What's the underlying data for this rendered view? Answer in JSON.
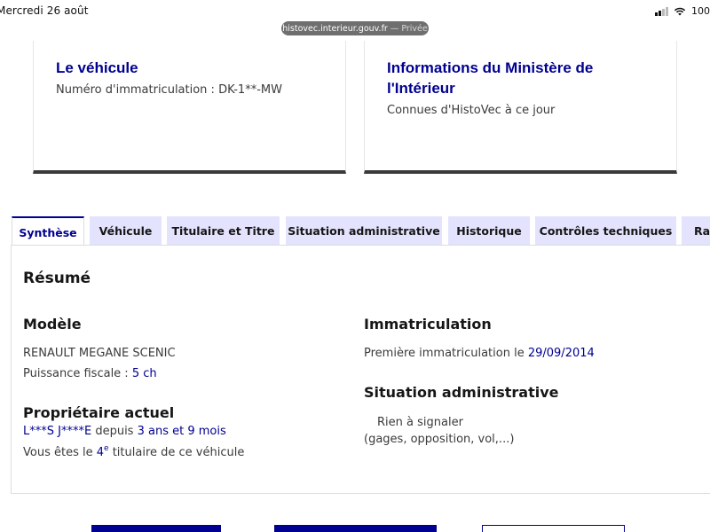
{
  "status_bar": {
    "time": "Mercredi 26 août",
    "battery": "100"
  },
  "browser": {
    "domain": "histovec.interieur.gouv.fr",
    "separator": "—",
    "mode": "Privée"
  },
  "cards": {
    "vehicle": {
      "title": "Le véhicule",
      "text": "Numéro d'immatriculation : DK-1**-MW"
    },
    "ministry": {
      "title": "Informations du Ministère de l'Intérieur",
      "text": "Connues d'HistoVec à ce jour"
    }
  },
  "tabs": [
    {
      "label": "Synthèse",
      "active": true
    },
    {
      "label": "Véhicule",
      "active": false
    },
    {
      "label": "Titulaire et Titre",
      "active": false
    },
    {
      "label": "Situation administrative",
      "active": false
    },
    {
      "label": "Historique",
      "active": false
    },
    {
      "label": "Contrôles techniques",
      "active": false
    },
    {
      "label": "Rap",
      "active": false
    }
  ],
  "summary": {
    "title": "Résumé",
    "model": {
      "heading": "Modèle",
      "name": "RENAULT MEGANE SCENIC",
      "power_label": "Puissance fiscale :",
      "power_value": "5 ch"
    },
    "owner": {
      "heading": "Propriétaire actuel",
      "name": "L***S J****E",
      "since_label": "depuis",
      "since_value": "3 ans et 9 mois",
      "rank_prefix": "Vous êtes le",
      "rank_number": "4",
      "rank_suffix_sup": "e",
      "rank_suffix": "titulaire de ce véhicule"
    },
    "registration": {
      "heading": "Immatriculation",
      "label": "Première immatriculation le",
      "date": "29/09/2014"
    },
    "admin": {
      "heading": "Situation administrative",
      "status": "Rien à signaler",
      "details": "(gages, opposition, vol,...)"
    }
  },
  "colors": {
    "primary": "#000091",
    "tab_bg": "#e3e3fd",
    "text": "#3a3a3a"
  }
}
